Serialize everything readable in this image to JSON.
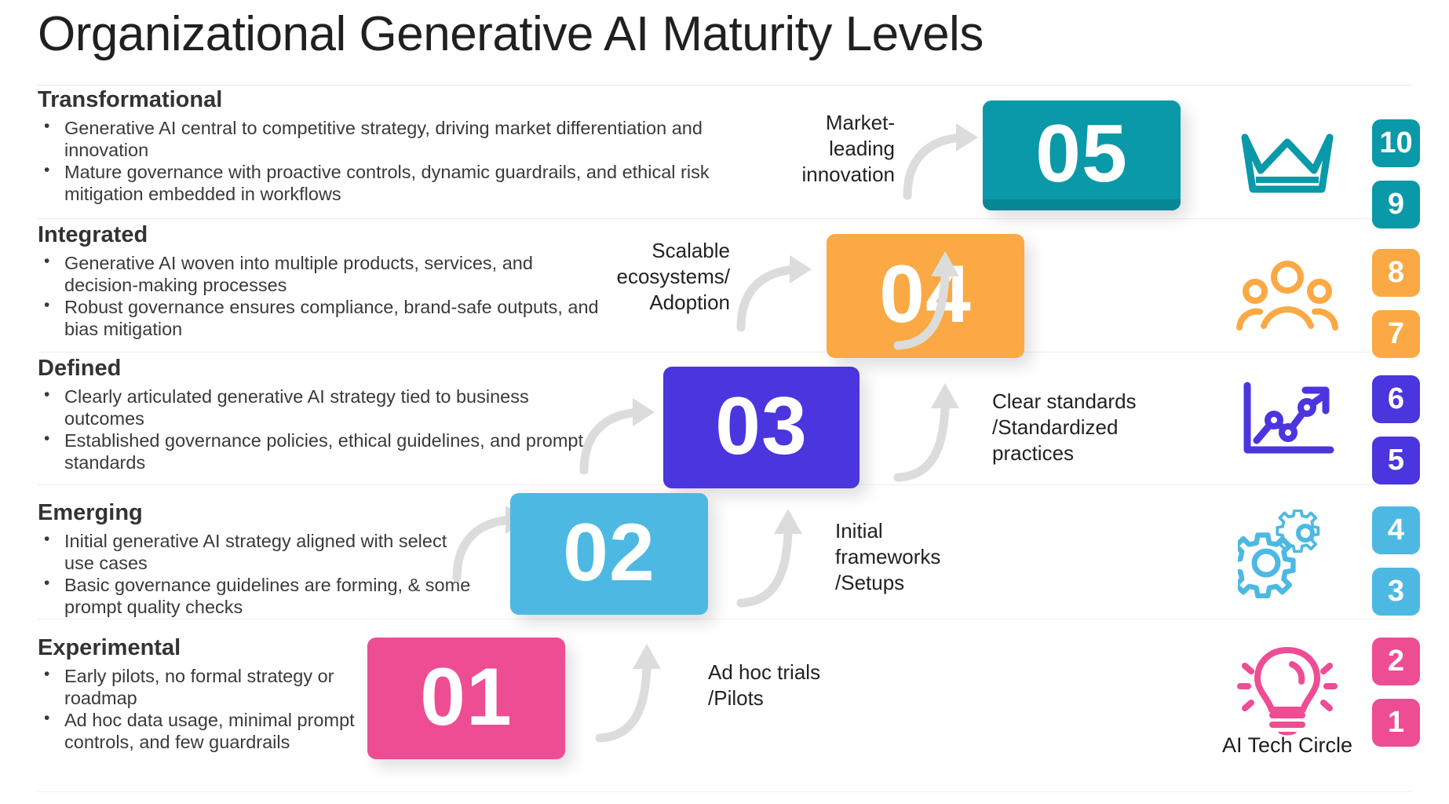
{
  "title": "Organizational Generative AI Maturity Levels",
  "brand_label": "AI Tech Circle",
  "colors": {
    "teal": "#0A99A8",
    "teal_dark": "#078796",
    "orange": "#FBA945",
    "purple": "#4B35DE",
    "blue": "#4DB9E3",
    "pink": "#EE4D94",
    "arrow_gray": "#DCDCDC",
    "text_dark": "#2B2B2B"
  },
  "levels": [
    {
      "number": "05",
      "name": "Transformational",
      "caption": "Market-\nleading\ninnovation",
      "caption_lines": [
        "Market-",
        "leading",
        "innovation"
      ],
      "icon": "crown-icon",
      "color": "#0A99A8",
      "chips": [
        "10",
        "9"
      ],
      "bullets": [
        "Generative AI central to competitive strategy, driving market differentiation and innovation",
        "Mature governance with proactive controls, dynamic guardrails, and ethical risk mitigation embedded in workflows"
      ]
    },
    {
      "number": "04",
      "name": "Integrated",
      "caption_lines": [
        "Scalable",
        "ecosystems/",
        "Adoption"
      ],
      "icon": "people-group-icon",
      "color": "#FBA945",
      "chips": [
        "8",
        "7"
      ],
      "bullets": [
        "Generative AI woven into multiple products, services, and decision-making processes",
        "Robust governance ensures compliance, brand-safe outputs, and bias mitigation"
      ]
    },
    {
      "number": "03",
      "name": "Defined",
      "caption_lines": [
        "Clear standards",
        "/Standardized",
        "practices"
      ],
      "icon": "line-chart-growth-icon",
      "color": "#4B35DE",
      "chips": [
        "6",
        "5"
      ],
      "bullets": [
        "Clearly articulated generative AI strategy tied to business outcomes",
        "Established governance policies, ethical guidelines, and prompt standards"
      ]
    },
    {
      "number": "02",
      "name": "Emerging",
      "caption_lines": [
        "Initial",
        "frameworks",
        "/Setups"
      ],
      "icon": "gears-icon",
      "color": "#4DB9E3",
      "chips": [
        "4",
        "3"
      ],
      "bullets": [
        "Initial generative AI strategy aligned with select use cases",
        "Basic governance guidelines are forming, & some prompt quality checks"
      ]
    },
    {
      "number": "01",
      "name": "Experimental",
      "caption_lines": [
        "Ad hoc trials",
        "/Pilots"
      ],
      "icon": "lightbulb-idea-icon",
      "color": "#EE4D94",
      "chips": [
        "2",
        "1"
      ],
      "bullets": [
        "Early pilots, no formal strategy or roadmap",
        "Ad hoc data usage, minimal prompt controls, and few guardrails"
      ]
    }
  ]
}
